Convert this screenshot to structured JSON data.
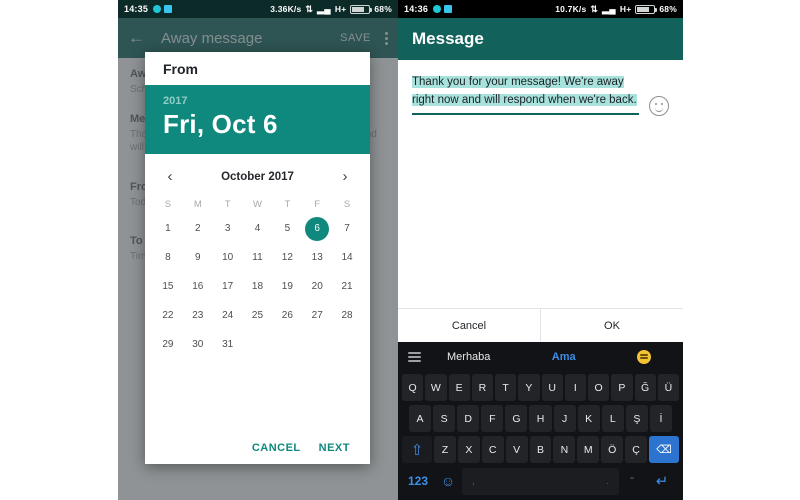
{
  "left_phone": {
    "status_bar": {
      "clock": "14:35",
      "speed": "3.36K/s",
      "network": "H+",
      "battery": "68%"
    },
    "appbar": {
      "back_icon": "arrow-left-icon",
      "title": "Away message",
      "save_label": "SAVE",
      "overflow_icon": "overflow-menu-icon"
    },
    "background_list": [
      {
        "title": "Away message",
        "subtitle": "Schedule"
      },
      {
        "title": "Message",
        "subtitle": "Thank you for your message! We're away right now and will respond when we're back."
      },
      {
        "title": "From",
        "subtitle": "Today"
      },
      {
        "title": "To",
        "subtitle": "Time"
      }
    ],
    "date_dialog": {
      "label": "From",
      "year": "2017",
      "date": "Fri, Oct 6",
      "prev_icon": "chevron-left-icon",
      "next_icon": "chevron-right-icon",
      "month_title": "October 2017",
      "day_headers": [
        "S",
        "M",
        "T",
        "W",
        "T",
        "F",
        "S"
      ],
      "leading_blanks": 0,
      "days": [
        1,
        2,
        3,
        4,
        5,
        6,
        7,
        8,
        9,
        10,
        11,
        12,
        13,
        14,
        15,
        16,
        17,
        18,
        19,
        20,
        21,
        22,
        23,
        24,
        25,
        26,
        27,
        28,
        29,
        30,
        31
      ],
      "selected_day": 6,
      "cancel_label": "CANCEL",
      "next_label": "NEXT",
      "accent_color": "#0f897e"
    }
  },
  "right_phone": {
    "status_bar": {
      "clock": "14:36",
      "speed": "10.7K/s",
      "network": "H+",
      "battery": "68%"
    },
    "appbar": {
      "title": "Message"
    },
    "message_dialog": {
      "text": "Thank you for your message! We're away right now and will respond when we're back.",
      "selected": true,
      "emoji_icon": "emoji-smiley-icon",
      "cancel_label": "Cancel",
      "ok_label": "OK"
    },
    "keyboard": {
      "menu_icon": "hamburger-menu-icon",
      "suggestions": [
        "Merhaba",
        "Ama"
      ],
      "suggestion_emoji_icon": "emoji-grin-icon",
      "row1": [
        "Q",
        "W",
        "E",
        "R",
        "T",
        "Y",
        "U",
        "I",
        "O",
        "P",
        "Ğ",
        "Ü"
      ],
      "row2": [
        "A",
        "S",
        "D",
        "F",
        "G",
        "H",
        "J",
        "K",
        "L",
        "Ş",
        "İ"
      ],
      "row3": [
        "Z",
        "X",
        "C",
        "V",
        "B",
        "N",
        "M",
        "Ö",
        "Ç"
      ],
      "shift_icon": "shift-up-icon",
      "backspace_icon": "backspace-icon",
      "numeric_label": "123",
      "emoji_key_icon": "emoji-key-icon",
      "space_left": ",",
      "space_right": ".",
      "quote_label": "\"",
      "enter_icon": "enter-return-icon",
      "accent_color": "#3b8fe8"
    }
  }
}
